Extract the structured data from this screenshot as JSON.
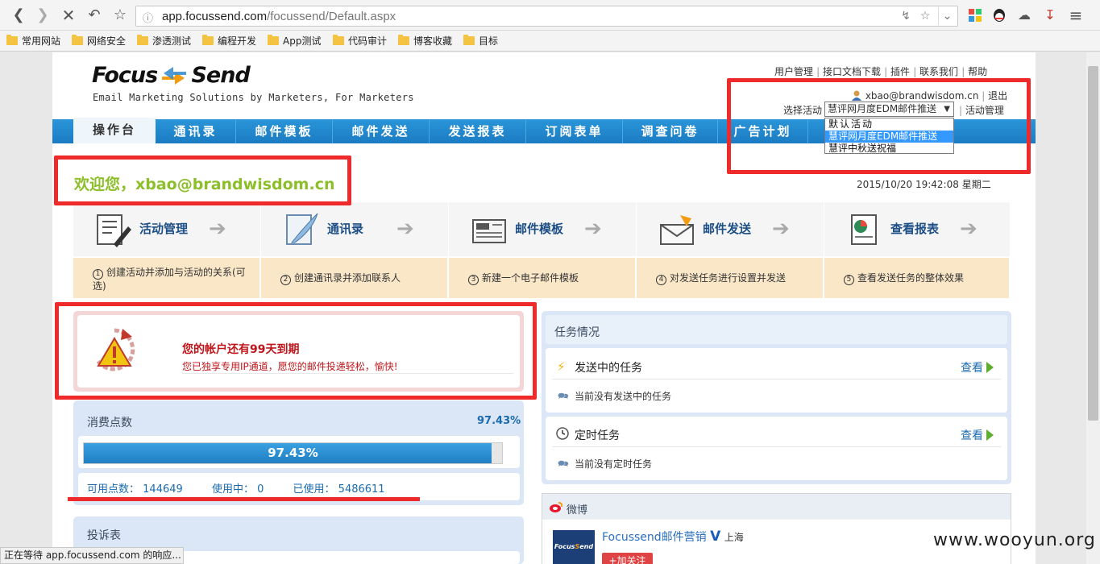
{
  "browser": {
    "url_domain": "app.focussend.com",
    "url_path": "/focussend/Default.aspx",
    "bookmarks": [
      "常用网站",
      "网络安全",
      "渗透测试",
      "编程开发",
      "App测试",
      "代码审计",
      "博客收藏",
      "目标"
    ],
    "status_text": "正在等待 app.focussend.com 的响应..."
  },
  "header": {
    "logo_left": "Focus",
    "logo_right": "Send",
    "tagline": "Email Marketing Solutions by Marketers, For Marketers",
    "top_links": [
      "用户管理",
      "接口文档下载",
      "插件",
      "联系我们",
      "帮助"
    ],
    "user_email": "xbao@brandwisdom.cn",
    "logout": "退出",
    "select_label": "选择活动",
    "selected_activity": "慧评网月度EDM邮件推送",
    "activity_manage": "活动管理",
    "activity_options": [
      "默认活动",
      "慧评网月度EDM邮件推送",
      "慧评中秋送祝福"
    ]
  },
  "nav": {
    "items": [
      "操作台",
      "通讯录",
      "邮件模板",
      "邮件发送",
      "发送报表",
      "订阅表单",
      "调查问卷",
      "广告计划"
    ]
  },
  "welcome": {
    "text": "欢迎您，xbao@brandwisdom.cn",
    "datetime": "2015/10/20 19:42:08 星期二"
  },
  "steps": [
    {
      "label": "活动管理",
      "num": "1",
      "desc": "创建活动并添加与活动的关系(可选)"
    },
    {
      "label": "通讯录",
      "num": "2",
      "desc": "创建通讯录并添加联系人"
    },
    {
      "label": "邮件模板",
      "num": "3",
      "desc": "新建一个电子邮件模板"
    },
    {
      "label": "邮件发送",
      "num": "4",
      "desc": "对发送任务进行设置并发送"
    },
    {
      "label": "查看报表",
      "num": "5",
      "desc": "查看发送任务的整体效果"
    }
  ],
  "account": {
    "expire": "您的帐户还有99天到期",
    "ip_note": "您已独享专用IP通道，愿您的邮件投递轻松，愉快!"
  },
  "consumption": {
    "title": "消费点数",
    "percent_label": "97.43%",
    "percent": 97.43,
    "available_label": "可用点数：",
    "available": "144649",
    "in_use_label": "使用中：",
    "in_use": "0",
    "used_label": "已使用：",
    "used": "5486611"
  },
  "complaints": {
    "title": "投诉表"
  },
  "tasks": {
    "title": "任务情况",
    "sending_title": "发送中的任务",
    "sending_view": "查看",
    "sending_note": "当前没有发送中的任务",
    "scheduled_title": "定时任务",
    "scheduled_view": "查看",
    "scheduled_note": "当前没有定时任务"
  },
  "weibo": {
    "title": "微博",
    "account": "Focussend邮件营销",
    "verified": "V",
    "location": "上海",
    "follow": "+加关注"
  },
  "watermark": "www.wooyun.org",
  "colors": {
    "nav": "#1b7bc2",
    "welcome": "#8cbf2a",
    "highlight": "#ee2a2a",
    "link": "#1b6bb0"
  }
}
